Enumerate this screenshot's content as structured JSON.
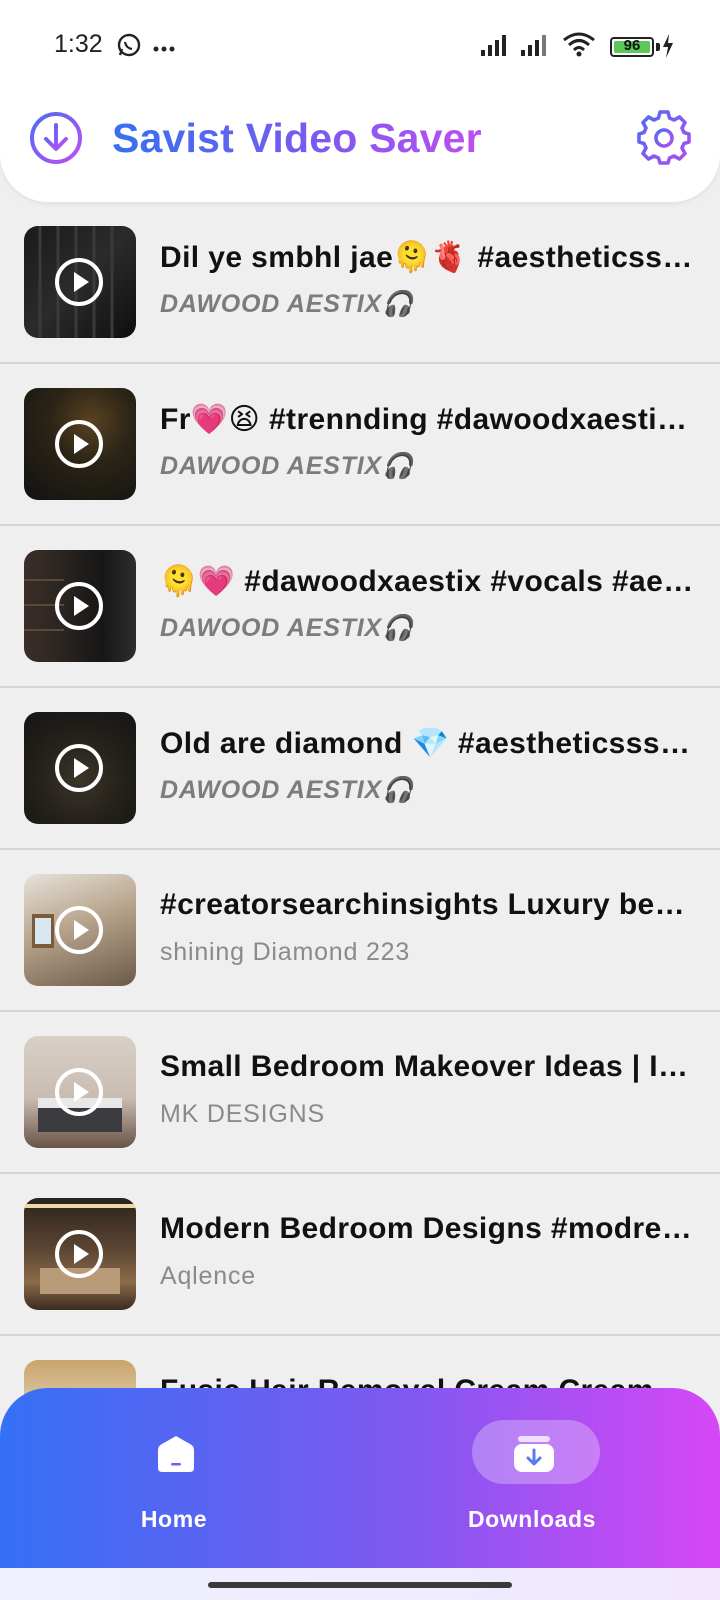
{
  "status_bar": {
    "time": "1:32",
    "battery_level": "96",
    "icons": [
      "whatsapp-icon",
      "more-dots-icon",
      "signal-icon",
      "signal-icon",
      "wifi-icon",
      "battery-icon",
      "charging-icon"
    ]
  },
  "app": {
    "title": "Savist Video Saver",
    "logo_icon": "download-circle-icon",
    "settings_icon": "gear-icon",
    "gradient_colors": [
      "#3571f0",
      "#7a5af0",
      "#c04ef2"
    ]
  },
  "videos": [
    {
      "title": "Dil ye smbhl jae🫠🫀 #aestheticsss #dawoodxaestix #vocals",
      "author": "DAWOOD AESTIX🎧",
      "author_style": "bold-italic"
    },
    {
      "title": "Fr💗😫 #trennding #dawoodxaestix #aesthetic",
      "author": "DAWOOD AESTIX🎧",
      "author_style": "bold-italic"
    },
    {
      "title": "🫠💗 #dawoodxaestix #vocals #aesthetic",
      "author": "DAWOOD AESTIX🎧",
      "author_style": "bold-italic"
    },
    {
      "title": "Old are diamond 💎 #aestheticsss #dawoodxaestix",
      "author": "DAWOOD AESTIX🎧",
      "author_style": "bold-italic"
    },
    {
      "title": "#creatorsearchinsights Luxury bedroom design",
      "author": "shining Diamond 223",
      "author_style": "regular"
    },
    {
      "title": "Small Bedroom Makeover Ideas | Interior",
      "author": "MK DESIGNS",
      "author_style": "regular"
    },
    {
      "title": "Modern Bedroom Designs #modrenbedroom",
      "author": "Aqlence",
      "author_style": "regular"
    },
    {
      "title": "Fusic Hair Removal Cream Cream",
      "author": "",
      "author_style": "regular"
    }
  ],
  "bottom_nav": {
    "items": [
      {
        "label": "Home",
        "icon": "home-icon",
        "selected": false
      },
      {
        "label": "Downloads",
        "icon": "downloads-icon",
        "selected": true
      }
    ]
  }
}
